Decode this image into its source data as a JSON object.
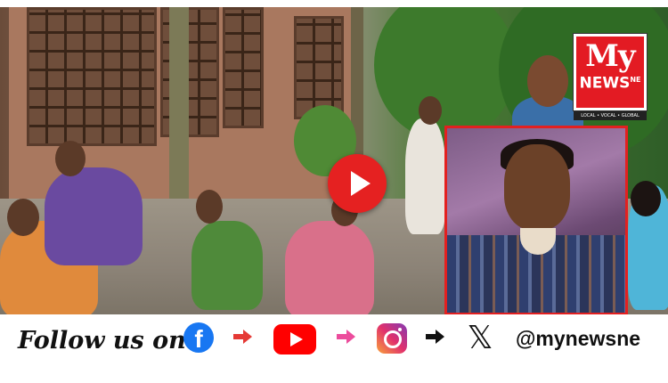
{
  "video": {
    "play_icon": "play-icon"
  },
  "logo": {
    "my": "My",
    "news": "NEWS",
    "suffix": "NE",
    "tagline": "LOCAL • VOCAL • GLOBAL"
  },
  "footer": {
    "follow_text": "Follow us on",
    "facebook_glyph": "f",
    "x_glyph": "𝕏",
    "handle": "@mynewsne",
    "icons": [
      "facebook-icon",
      "youtube-icon",
      "instagram-icon",
      "x-icon"
    ],
    "arrow_colors": [
      "#e53935",
      "#ec4c9c",
      "#111111"
    ]
  },
  "colors": {
    "accent_red": "#e31b23",
    "play_red": "#e52121",
    "facebook_blue": "#1877f2",
    "youtube_red": "#ff0000"
  }
}
